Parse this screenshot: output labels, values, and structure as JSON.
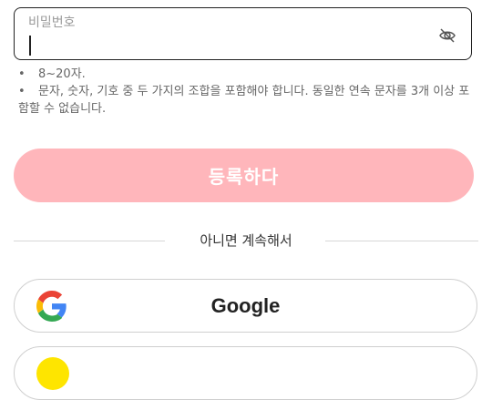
{
  "password": {
    "label": "비밀번호",
    "value": "",
    "toggle_icon": "eye-off-icon"
  },
  "rules": [
    "8~20자.",
    "문자, 숫자, 기호 중 두 가지의 조합을 포함해야 합니다. 동일한 연속 문자를 3개 이상 포함할 수 없습니다."
  ],
  "bullet": "•",
  "register_label": "등록하다",
  "register_color": "#ffb6bb",
  "divider_text": "아니면 계속해서",
  "social": {
    "google": {
      "label": "Google",
      "icon": "google-logo-icon"
    },
    "kakao": {
      "label": "",
      "icon": "kakao-logo-icon",
      "color": "#fee500"
    }
  }
}
